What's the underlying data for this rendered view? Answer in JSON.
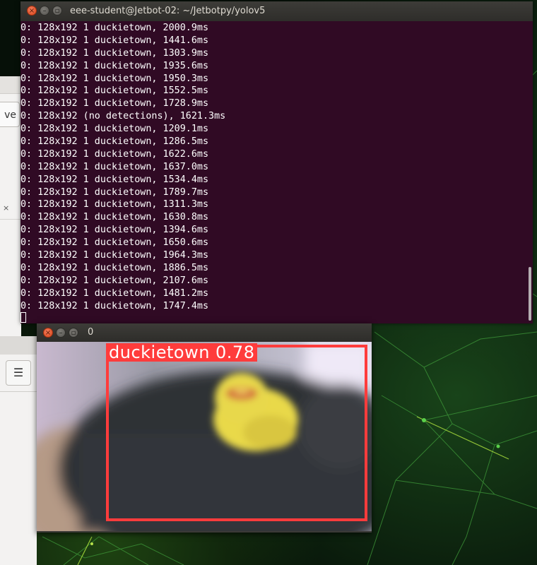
{
  "terminal": {
    "title": "eee-student@Jetbot-02: ~/Jetbotpy/yolov5",
    "lines": [
      "0: 128x192 1 duckietown, 2000.9ms",
      "0: 128x192 1 duckietown, 1441.6ms",
      "0: 128x192 1 duckietown, 1303.9ms",
      "0: 128x192 1 duckietown, 1935.6ms",
      "0: 128x192 1 duckietown, 1950.3ms",
      "0: 128x192 1 duckietown, 1552.5ms",
      "0: 128x192 1 duckietown, 1728.9ms",
      "0: 128x192 (no detections), 1621.3ms",
      "0: 128x192 1 duckietown, 1209.1ms",
      "0: 128x192 1 duckietown, 1286.5ms",
      "0: 128x192 1 duckietown, 1622.6ms",
      "0: 128x192 1 duckietown, 1637.0ms",
      "0: 128x192 1 duckietown, 1534.4ms",
      "0: 128x192 1 duckietown, 1789.7ms",
      "0: 128x192 1 duckietown, 1311.3ms",
      "0: 128x192 1 duckietown, 1630.8ms",
      "0: 128x192 1 duckietown, 1394.6ms",
      "0: 128x192 1 duckietown, 1650.6ms",
      "0: 128x192 1 duckietown, 1964.3ms",
      "0: 128x192 1 duckietown, 1886.5ms",
      "0: 128x192 1 duckietown, 2107.6ms",
      "0: 128x192 1 duckietown, 1481.2ms",
      "0: 128x192 1 duckietown, 1747.4ms"
    ],
    "background_color": "#300a24",
    "text_color": "#ffffff"
  },
  "image_window": {
    "title": "0",
    "detection_label": "duckietown 0.78",
    "box_color": "#ff3c3c"
  },
  "background_windows": {
    "left_button_label": "ve",
    "close_glyph": "×",
    "menu_glyph": "☰"
  },
  "icons": [
    "close-icon",
    "minimize-icon",
    "maximize-icon",
    "hamburger-menu-icon"
  ]
}
